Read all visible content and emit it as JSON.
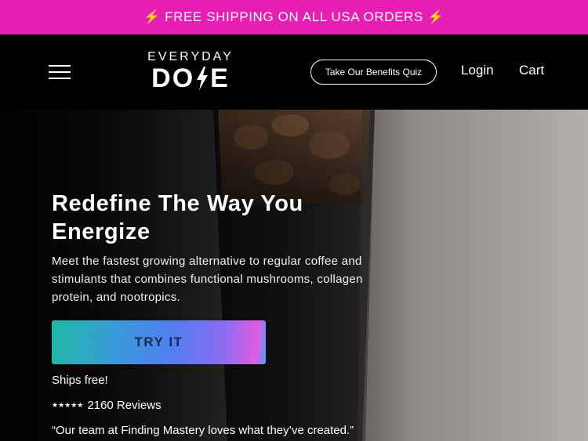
{
  "announcement": {
    "text": "⚡ FREE SHIPPING ON ALL USA ORDERS ⚡"
  },
  "header": {
    "menu_icon": "hamburger-menu-icon",
    "logo": {
      "top": "EVERYDAY",
      "bottom": "DOSE"
    },
    "quiz_label": "Take Our Benefits Quiz",
    "login_label": "Login",
    "cart_label": "Cart"
  },
  "hero": {
    "title": "Redefine The Way You Energize",
    "subtitle": "Meet the fastest growing alternative to regular coffee and stimulants that combines functional mushrooms, collagen protein, and nootropics.",
    "cta_label": "TRY IT",
    "shipping_note": "Ships free!",
    "stars": "★★★★★",
    "rating_value": 5,
    "reviews": "2160 Reviews",
    "quote": "“Our team at Finding Mastery loves what they’ve created.”"
  },
  "colors": {
    "announcement_bg": "#e61eb4",
    "header_bg": "#000000",
    "cta_text": "#1a2a55"
  }
}
